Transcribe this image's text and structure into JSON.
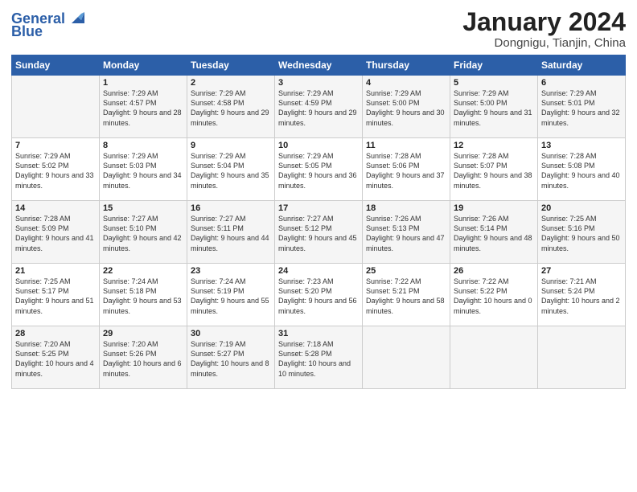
{
  "logo": {
    "line1": "General",
    "line2": "Blue"
  },
  "title": "January 2024",
  "location": "Dongnigu, Tianjin, China",
  "days_of_week": [
    "Sunday",
    "Monday",
    "Tuesday",
    "Wednesday",
    "Thursday",
    "Friday",
    "Saturday"
  ],
  "weeks": [
    [
      {
        "day": "",
        "sunrise": "",
        "sunset": "",
        "daylight": ""
      },
      {
        "day": "1",
        "sunrise": "Sunrise: 7:29 AM",
        "sunset": "Sunset: 4:57 PM",
        "daylight": "Daylight: 9 hours and 28 minutes."
      },
      {
        "day": "2",
        "sunrise": "Sunrise: 7:29 AM",
        "sunset": "Sunset: 4:58 PM",
        "daylight": "Daylight: 9 hours and 29 minutes."
      },
      {
        "day": "3",
        "sunrise": "Sunrise: 7:29 AM",
        "sunset": "Sunset: 4:59 PM",
        "daylight": "Daylight: 9 hours and 29 minutes."
      },
      {
        "day": "4",
        "sunrise": "Sunrise: 7:29 AM",
        "sunset": "Sunset: 5:00 PM",
        "daylight": "Daylight: 9 hours and 30 minutes."
      },
      {
        "day": "5",
        "sunrise": "Sunrise: 7:29 AM",
        "sunset": "Sunset: 5:00 PM",
        "daylight": "Daylight: 9 hours and 31 minutes."
      },
      {
        "day": "6",
        "sunrise": "Sunrise: 7:29 AM",
        "sunset": "Sunset: 5:01 PM",
        "daylight": "Daylight: 9 hours and 32 minutes."
      }
    ],
    [
      {
        "day": "7",
        "sunrise": "Sunrise: 7:29 AM",
        "sunset": "Sunset: 5:02 PM",
        "daylight": "Daylight: 9 hours and 33 minutes."
      },
      {
        "day": "8",
        "sunrise": "Sunrise: 7:29 AM",
        "sunset": "Sunset: 5:03 PM",
        "daylight": "Daylight: 9 hours and 34 minutes."
      },
      {
        "day": "9",
        "sunrise": "Sunrise: 7:29 AM",
        "sunset": "Sunset: 5:04 PM",
        "daylight": "Daylight: 9 hours and 35 minutes."
      },
      {
        "day": "10",
        "sunrise": "Sunrise: 7:29 AM",
        "sunset": "Sunset: 5:05 PM",
        "daylight": "Daylight: 9 hours and 36 minutes."
      },
      {
        "day": "11",
        "sunrise": "Sunrise: 7:28 AM",
        "sunset": "Sunset: 5:06 PM",
        "daylight": "Daylight: 9 hours and 37 minutes."
      },
      {
        "day": "12",
        "sunrise": "Sunrise: 7:28 AM",
        "sunset": "Sunset: 5:07 PM",
        "daylight": "Daylight: 9 hours and 38 minutes."
      },
      {
        "day": "13",
        "sunrise": "Sunrise: 7:28 AM",
        "sunset": "Sunset: 5:08 PM",
        "daylight": "Daylight: 9 hours and 40 minutes."
      }
    ],
    [
      {
        "day": "14",
        "sunrise": "Sunrise: 7:28 AM",
        "sunset": "Sunset: 5:09 PM",
        "daylight": "Daylight: 9 hours and 41 minutes."
      },
      {
        "day": "15",
        "sunrise": "Sunrise: 7:27 AM",
        "sunset": "Sunset: 5:10 PM",
        "daylight": "Daylight: 9 hours and 42 minutes."
      },
      {
        "day": "16",
        "sunrise": "Sunrise: 7:27 AM",
        "sunset": "Sunset: 5:11 PM",
        "daylight": "Daylight: 9 hours and 44 minutes."
      },
      {
        "day": "17",
        "sunrise": "Sunrise: 7:27 AM",
        "sunset": "Sunset: 5:12 PM",
        "daylight": "Daylight: 9 hours and 45 minutes."
      },
      {
        "day": "18",
        "sunrise": "Sunrise: 7:26 AM",
        "sunset": "Sunset: 5:13 PM",
        "daylight": "Daylight: 9 hours and 47 minutes."
      },
      {
        "day": "19",
        "sunrise": "Sunrise: 7:26 AM",
        "sunset": "Sunset: 5:14 PM",
        "daylight": "Daylight: 9 hours and 48 minutes."
      },
      {
        "day": "20",
        "sunrise": "Sunrise: 7:25 AM",
        "sunset": "Sunset: 5:16 PM",
        "daylight": "Daylight: 9 hours and 50 minutes."
      }
    ],
    [
      {
        "day": "21",
        "sunrise": "Sunrise: 7:25 AM",
        "sunset": "Sunset: 5:17 PM",
        "daylight": "Daylight: 9 hours and 51 minutes."
      },
      {
        "day": "22",
        "sunrise": "Sunrise: 7:24 AM",
        "sunset": "Sunset: 5:18 PM",
        "daylight": "Daylight: 9 hours and 53 minutes."
      },
      {
        "day": "23",
        "sunrise": "Sunrise: 7:24 AM",
        "sunset": "Sunset: 5:19 PM",
        "daylight": "Daylight: 9 hours and 55 minutes."
      },
      {
        "day": "24",
        "sunrise": "Sunrise: 7:23 AM",
        "sunset": "Sunset: 5:20 PM",
        "daylight": "Daylight: 9 hours and 56 minutes."
      },
      {
        "day": "25",
        "sunrise": "Sunrise: 7:22 AM",
        "sunset": "Sunset: 5:21 PM",
        "daylight": "Daylight: 9 hours and 58 minutes."
      },
      {
        "day": "26",
        "sunrise": "Sunrise: 7:22 AM",
        "sunset": "Sunset: 5:22 PM",
        "daylight": "Daylight: 10 hours and 0 minutes."
      },
      {
        "day": "27",
        "sunrise": "Sunrise: 7:21 AM",
        "sunset": "Sunset: 5:24 PM",
        "daylight": "Daylight: 10 hours and 2 minutes."
      }
    ],
    [
      {
        "day": "28",
        "sunrise": "Sunrise: 7:20 AM",
        "sunset": "Sunset: 5:25 PM",
        "daylight": "Daylight: 10 hours and 4 minutes."
      },
      {
        "day": "29",
        "sunrise": "Sunrise: 7:20 AM",
        "sunset": "Sunset: 5:26 PM",
        "daylight": "Daylight: 10 hours and 6 minutes."
      },
      {
        "day": "30",
        "sunrise": "Sunrise: 7:19 AM",
        "sunset": "Sunset: 5:27 PM",
        "daylight": "Daylight: 10 hours and 8 minutes."
      },
      {
        "day": "31",
        "sunrise": "Sunrise: 7:18 AM",
        "sunset": "Sunset: 5:28 PM",
        "daylight": "Daylight: 10 hours and 10 minutes."
      },
      {
        "day": "",
        "sunrise": "",
        "sunset": "",
        "daylight": ""
      },
      {
        "day": "",
        "sunrise": "",
        "sunset": "",
        "daylight": ""
      },
      {
        "day": "",
        "sunrise": "",
        "sunset": "",
        "daylight": ""
      }
    ]
  ]
}
